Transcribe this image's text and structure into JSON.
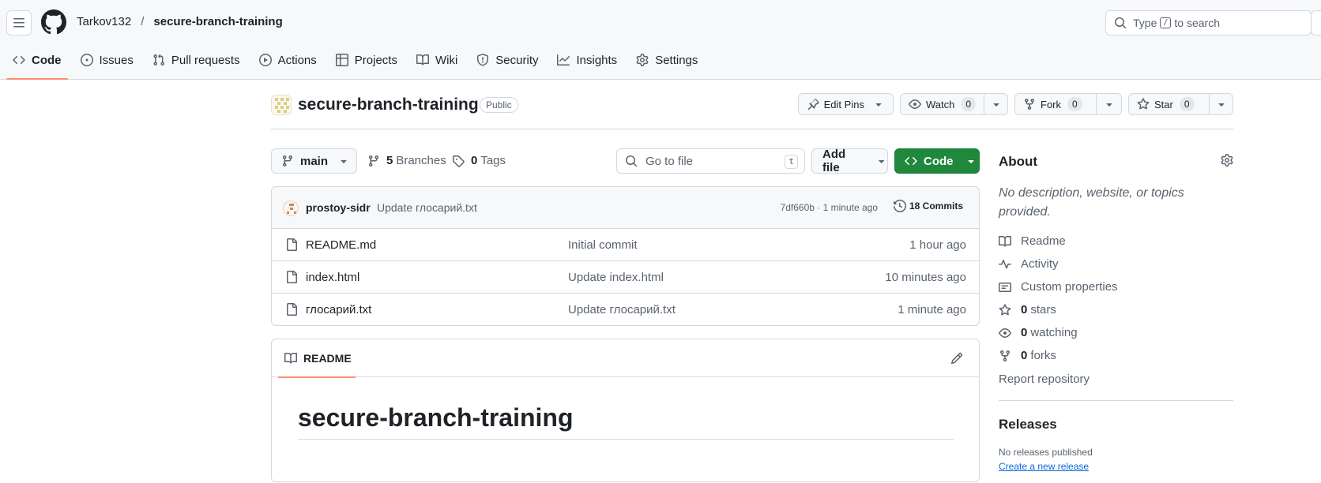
{
  "header": {
    "owner": "Tarkov132",
    "separator": "/",
    "repo": "secure-branch-training",
    "search_prefix": "Type",
    "search_key": "/",
    "search_suffix": "to search"
  },
  "tabs": [
    {
      "label": "Code",
      "icon": "code-icon",
      "active": true
    },
    {
      "label": "Issues",
      "icon": "issue-icon"
    },
    {
      "label": "Pull requests",
      "icon": "pull-request-icon"
    },
    {
      "label": "Actions",
      "icon": "play-icon"
    },
    {
      "label": "Projects",
      "icon": "table-icon"
    },
    {
      "label": "Wiki",
      "icon": "book-icon"
    },
    {
      "label": "Security",
      "icon": "shield-icon"
    },
    {
      "label": "Insights",
      "icon": "graph-icon"
    },
    {
      "label": "Settings",
      "icon": "gear-icon"
    }
  ],
  "repo": {
    "name": "secure-branch-training",
    "visibility": "Public",
    "edit_pins": "Edit Pins",
    "watch": "Watch",
    "watch_count": "0",
    "fork": "Fork",
    "fork_count": "0",
    "star": "Star",
    "star_count": "0"
  },
  "file_nav": {
    "branch": "main",
    "branches_count": "5",
    "branches_label": "Branches",
    "tags_count": "0",
    "tags_label": "Tags",
    "goto_placeholder": "Go to file",
    "goto_key": "t",
    "add_file": "Add file",
    "code_button": "Code"
  },
  "latest_commit": {
    "author": "prostoy-sidr",
    "message": "Update глосарий.txt",
    "sha_time": "7df660b · 1 minute ago",
    "commits": "18 Commits"
  },
  "files": [
    {
      "name": "README.md",
      "message": "Initial commit",
      "time": "1 hour ago"
    },
    {
      "name": "index.html",
      "message": "Update index.html",
      "time": "10 minutes ago"
    },
    {
      "name": "глосарий.txt",
      "message": "Update глосарий.txt",
      "time": "1 minute ago"
    }
  ],
  "readme": {
    "tab_label": "README",
    "heading": "secure-branch-training"
  },
  "about": {
    "title": "About",
    "description": "No description, website, or topics provided.",
    "readme": "Readme",
    "activity": "Activity",
    "custom_properties": "Custom properties",
    "stars_count": "0",
    "stars_label": "stars",
    "watching_count": "0",
    "watching_label": "watching",
    "forks_count": "0",
    "forks_label": "forks",
    "report": "Report repository"
  },
  "releases": {
    "title": "Releases",
    "none": "No releases published",
    "create": "Create a new release"
  },
  "colors": {
    "accent_green": "#1f883d",
    "tab_underline": "#fd8c73",
    "link_blue": "#0969da",
    "muted": "#59636e",
    "border": "#d1d9e0"
  }
}
